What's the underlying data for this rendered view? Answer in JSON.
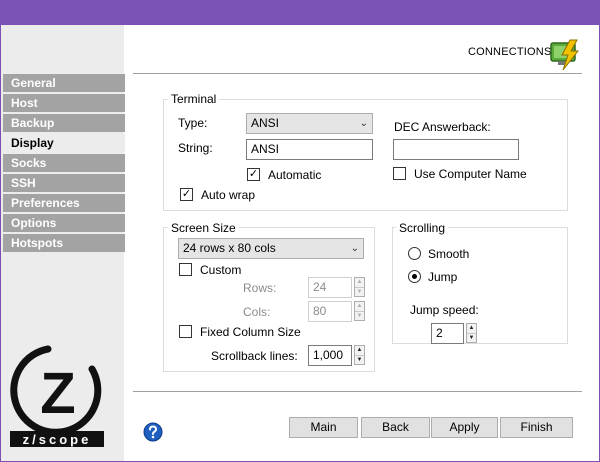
{
  "sidebar": {
    "items": [
      {
        "label": "General",
        "active": false
      },
      {
        "label": "Host",
        "active": false
      },
      {
        "label": "Backup",
        "active": false
      },
      {
        "label": "Display",
        "active": true
      },
      {
        "label": "Socks",
        "active": false
      },
      {
        "label": "SSH",
        "active": false
      },
      {
        "label": "Preferences",
        "active": false
      },
      {
        "label": "Options",
        "active": false
      },
      {
        "label": "Hotspots",
        "active": false
      }
    ]
  },
  "header": {
    "connections_label": "CONNECTIONS",
    "connections_icon": "lightning-monitor-icon"
  },
  "terminal": {
    "title": "Terminal",
    "type_label": "Type:",
    "type_value": "ANSI",
    "string_label": "String:",
    "string_value": "ANSI",
    "automatic_label": "Automatic",
    "automatic_checked": true,
    "auto_wrap_label": "Auto wrap",
    "auto_wrap_checked": true,
    "dec_answerback_label": "DEC Answerback:",
    "dec_answerback_value": "",
    "use_computer_name_label": "Use Computer Name",
    "use_computer_name_checked": false
  },
  "screen_size": {
    "title": "Screen Size",
    "preset_value": "24 rows x 80 cols",
    "custom_label": "Custom",
    "custom_checked": false,
    "rows_label": "Rows:",
    "rows_value": "24",
    "cols_label": "Cols:",
    "cols_value": "80",
    "fixed_column_label": "Fixed Column Size",
    "fixed_column_checked": false,
    "scrollback_label": "Scrollback lines:",
    "scrollback_value": "1,000"
  },
  "scrolling": {
    "title": "Scrolling",
    "smooth_label": "Smooth",
    "jump_label": "Jump",
    "selected": "Jump",
    "jump_speed_label": "Jump speed:",
    "jump_speed_value": "2"
  },
  "footer": {
    "main_label": "Main",
    "back_label": "Back",
    "apply_label": "Apply",
    "finish_label": "Finish"
  },
  "logo": {
    "letter": "Z",
    "wordmark": "z/scope"
  },
  "icons": {
    "help": "help-icon",
    "dropdown": "chevron-down-icon",
    "checkmark": "checkmark-icon",
    "spin_up": "spin-up-icon",
    "spin_down": "spin-down-icon"
  },
  "colors": {
    "titlebar": "#7b51b5",
    "nav_inactive": "#a3a3a3",
    "nav_active_bg": "#ececec",
    "help_blue": "#1f5fbf",
    "bolt_yellow": "#f2c200",
    "monitor_green": "#3f8d2d"
  }
}
